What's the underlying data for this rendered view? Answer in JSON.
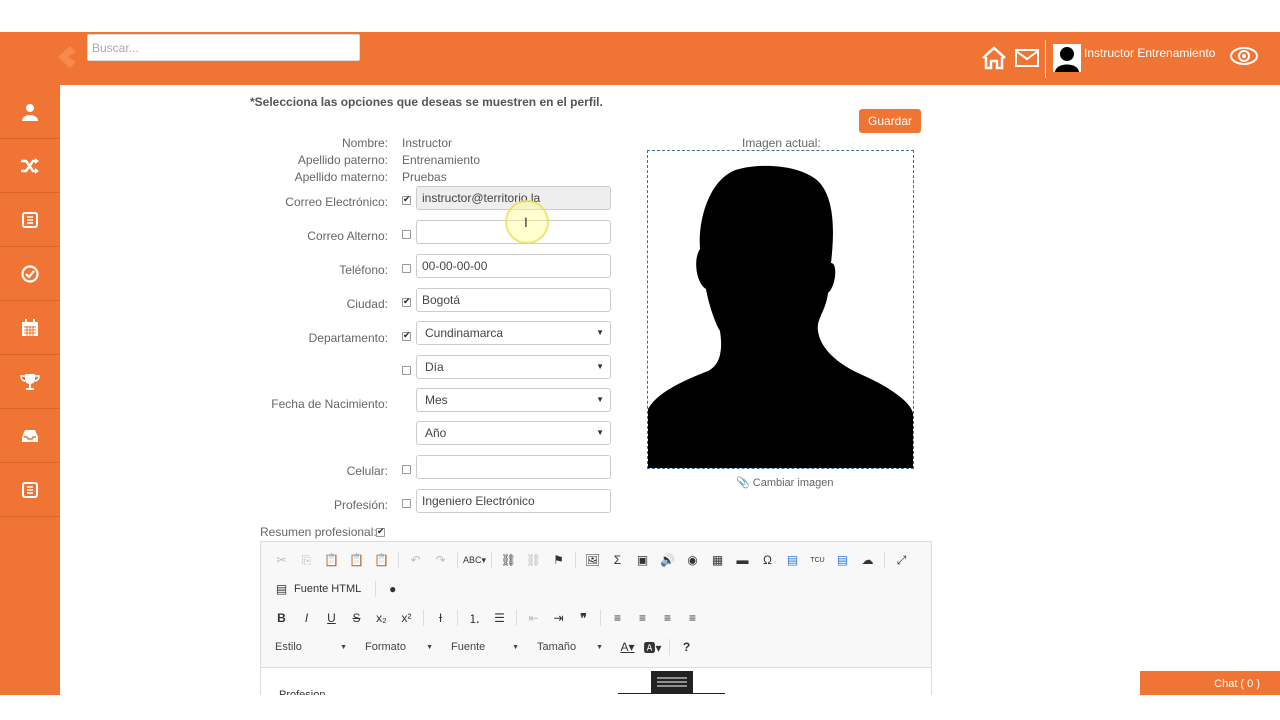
{
  "header": {
    "search_placeholder": "Buscar...",
    "user_name": "Instructor Entrenamiento"
  },
  "sidebar": {
    "items": [
      {
        "icon": "user-icon"
      },
      {
        "icon": "shuffle-icon"
      },
      {
        "icon": "list-icon"
      },
      {
        "icon": "check-circle-icon"
      },
      {
        "icon": "calendar-icon"
      },
      {
        "icon": "trophy-icon"
      },
      {
        "icon": "inbox-icon"
      },
      {
        "icon": "list-icon"
      }
    ]
  },
  "profile": {
    "intro": "*Selecciona las opciones que deseas se muestren en el perfil.",
    "save_label": "Guardar",
    "nombre_label": "Nombre:",
    "nombre_value": "Instructor",
    "apellido_paterno_label": "Apellido paterno:",
    "apellido_paterno_value": "Entrenamiento",
    "apellido_materno_label": "Apellido materno:",
    "apellido_materno_value": "Pruebas",
    "correo_label": "Correo Electrónico:",
    "correo_value": "instructor@territorio.la",
    "correo_alterno_label": "Correo Alterno:",
    "correo_alterno_value": "",
    "telefono_label": "Teléfono:",
    "telefono_value": "00-00-00-00",
    "ciudad_label": "Ciudad:",
    "ciudad_value": "Bogotá",
    "departamento_label": "Departamento:",
    "departamento_value": "Cundinamarca",
    "fecha_label": "Fecha de Nacimiento:",
    "dia_value": "Día",
    "mes_value": "Mes",
    "anio_value": "Año",
    "celular_label": "Celular:",
    "celular_value": "",
    "profesion_label": "Profesión:",
    "profesion_value": "Ingeniero Electrónico",
    "imagen_label": "Imagen actual:",
    "cambiar_imagen": "Cambiar imagen",
    "resumen_label": "Resumen profesional:"
  },
  "editor": {
    "source_label": "Fuente HTML",
    "estilo": "Estilo",
    "formato": "Formato",
    "fuente": "Fuente",
    "tamano": "Tamaño",
    "body_text": "Profesion"
  },
  "chat_label": "Chat ( 0 )",
  "colors": {
    "accent": "#f07434",
    "border": "#cccccc"
  }
}
